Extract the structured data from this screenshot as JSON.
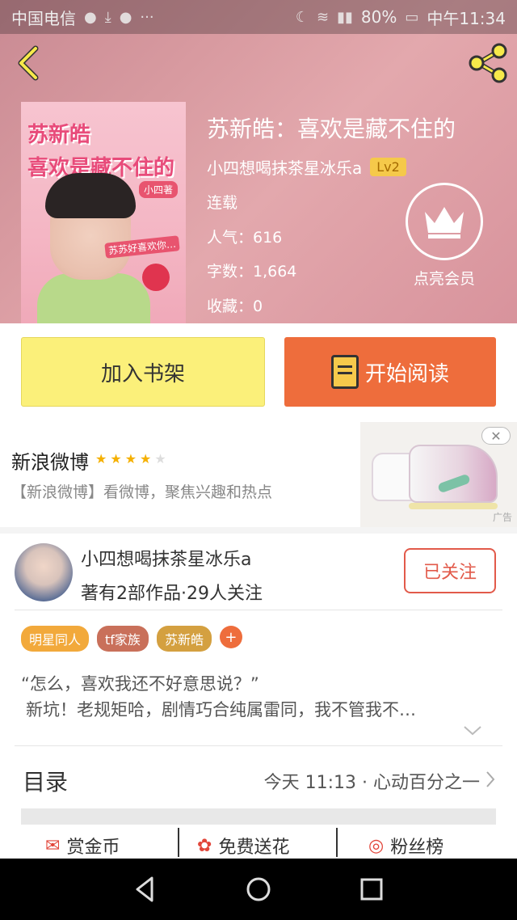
{
  "status_bar": {
    "carrier": "中国电信",
    "battery": "80%",
    "time": "中午11:34"
  },
  "book": {
    "title": "苏新皓：喜欢是藏不住的",
    "author": "小四想喝抹茶星冰乐a",
    "level": "Lv2",
    "status": "连载",
    "popularity": "人气：616",
    "word_count": "字数：1,664",
    "favorites": "收藏：0",
    "vip_label": "点亮会员"
  },
  "cover": {
    "line1": "苏新皓",
    "line2": "喜欢是藏不住的",
    "author_tag": "小四著",
    "caption": "苏苏好喜欢你…"
  },
  "actions": {
    "add_shelf": "加入书架",
    "start_read": "开始阅读"
  },
  "ad": {
    "title": "新浪微博",
    "rating": 4,
    "desc": "【新浪微博】看微博，聚焦兴趣和热点",
    "close": "✕",
    "mark": "广告"
  },
  "author_section": {
    "name": "小四想喝抹茶星冰乐a",
    "stats": "著有2部作品·29人关注",
    "follow_label": "已关注",
    "tags": [
      {
        "label": "明星同人",
        "color": "#f2a93b"
      },
      {
        "label": "tf家族",
        "color": "#c9705a"
      },
      {
        "label": "苏新皓",
        "color": "#d4a040"
      }
    ],
    "tag_add": "+",
    "intro_line1": "“怎么，喜欢我还不好意思说？”",
    "intro_line2": "新坑！老规矩哈，剧情巧合纯属雷同，我不管我不…",
    "toc_label": "目录",
    "toc_latest": "今天 11:13 · 心动百分之一"
  },
  "bottom_strip": {
    "reward": "赏金币",
    "flower": "免费送花",
    "fans": "粉丝榜"
  },
  "colors": {
    "accent_orange": "#ee6d3c",
    "shelf_yellow": "#fbf07a",
    "follow_red": "#e25a4a",
    "star_gold": "#f5b000"
  }
}
